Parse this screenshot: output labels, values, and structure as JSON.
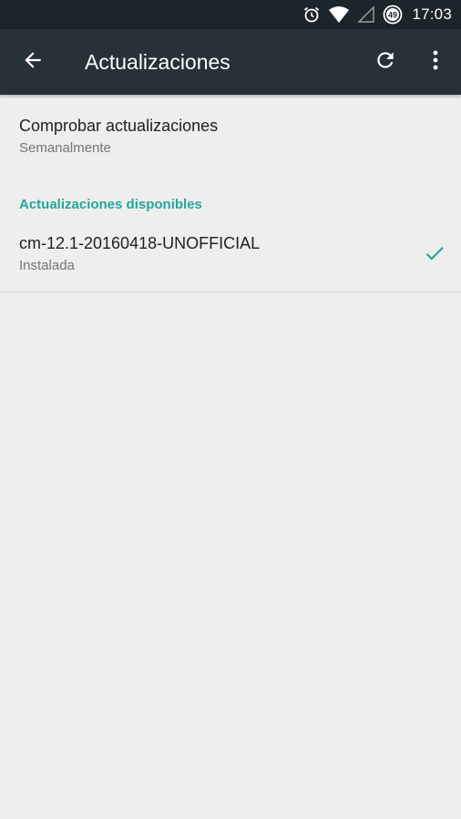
{
  "status_bar": {
    "time": "17:03",
    "battery_level": "49",
    "icons": [
      "alarm-icon",
      "wifi-icon",
      "signal-icon",
      "battery-icon"
    ]
  },
  "toolbar": {
    "title": "Actualizaciones",
    "back_icon": "arrow-back-icon",
    "refresh_icon": "refresh-icon",
    "overflow_icon": "more-vert-icon"
  },
  "check_updates": {
    "title": "Comprobar actualizaciones",
    "summary": "Semanalmente"
  },
  "available": {
    "header": "Actualizaciones disponibles",
    "items": [
      {
        "title": "cm-12.1-20160418-UNOFFICIAL",
        "summary": "Instalada",
        "status_icon": "check-icon"
      }
    ]
  },
  "colors": {
    "toolbar": "#263238",
    "status_bar": "#1c2529",
    "accent": "#26a69a",
    "background": "#eeeeee"
  }
}
